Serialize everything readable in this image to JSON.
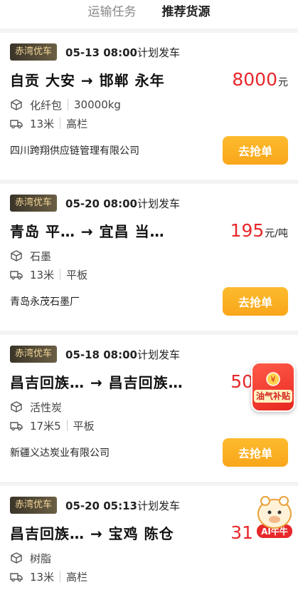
{
  "tabs": [
    {
      "label": "运输任务",
      "active": false
    },
    {
      "label": "推荐货源",
      "active": true
    }
  ],
  "cards": [
    {
      "badge": "赤湾优车",
      "date": "05-13 08:00",
      "plan_text": "计划发车",
      "route": "自贡 大安 → 邯郸 永年",
      "price": "8000",
      "unit": "元",
      "cargo": "化纤包",
      "weight": "30000kg",
      "length": "13米",
      "truck_type": "高栏",
      "company": "四川跨翔供应链管理有限公司",
      "button": "去抢单"
    },
    {
      "badge": "赤湾优车",
      "date": "05-20 08:00",
      "plan_text": "计划发车",
      "route": "青岛 平… → 宜昌 当…",
      "price": "195",
      "unit": "元/吨",
      "cargo": "石墨",
      "weight": "",
      "length": "13米",
      "truck_type": "平板",
      "company": "青岛永茂石墨厂",
      "button": "去抢单"
    },
    {
      "badge": "赤湾优车",
      "date": "05-18 08:00",
      "plan_text": "计划发车",
      "route": "昌吉回族… → 昌吉回族…",
      "price": "50",
      "unit": "",
      "cargo": "活性炭",
      "weight": "",
      "length": "17米5",
      "truck_type": "平板",
      "company": "新疆义达炭业有限公司",
      "button": "去抢单"
    },
    {
      "badge": "赤湾优车",
      "date": "05-20 05:13",
      "plan_text": "计划发车",
      "route": "昌吉回族… → 宝鸡 陈仓",
      "price": "31",
      "unit": "",
      "cargo": "树脂",
      "weight": "",
      "length": "13米",
      "truck_type": "高栏",
      "company": "",
      "button": ""
    }
  ],
  "floats": {
    "subsidy_label": "油气补贴",
    "ai_label": "AI牛牛"
  },
  "colors": {
    "accent": "#f9a61a",
    "price": "#e8272b",
    "badge_text": "#f6d89a"
  }
}
